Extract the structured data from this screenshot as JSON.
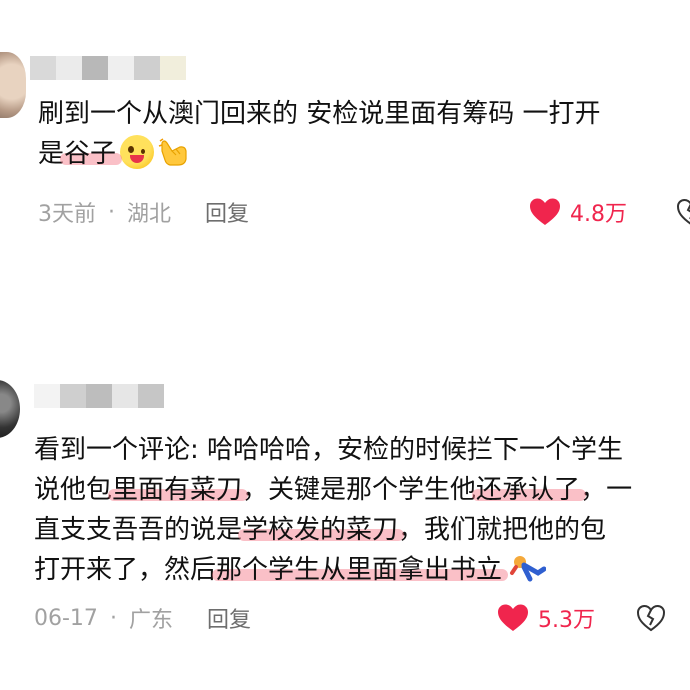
{
  "comments": [
    {
      "lines": [
        [
          {
            "text": "刷到一个从澳门回来的 安检说里面有筹码 一打开",
            "hl": false
          }
        ],
        [
          {
            "text": "是",
            "hl": false
          },
          {
            "text": "谷子",
            "hl": true
          }
        ]
      ],
      "emojis": [
        "winking-tongue-face-icon",
        "pointing-hand-icon"
      ],
      "time": "3天前",
      "location": "湖北",
      "reply_label": "回复",
      "likes": "4.8万",
      "icons": [
        "heart-icon",
        "broken-heart-icon"
      ]
    },
    {
      "lines": [
        [
          {
            "text": "看到一个评论: 哈哈哈哈，安检的时候拦下一个学生",
            "hl": false
          }
        ],
        [
          {
            "text": "说他包",
            "hl": false
          },
          {
            "text": "里面有菜刀",
            "hl": true
          },
          {
            "text": "，关键是那个学生他",
            "hl": false
          },
          {
            "text": "还承认了",
            "hl": true
          },
          {
            "text": "，一",
            "hl": false
          }
        ],
        [
          {
            "text": "直支支吾吾的说是",
            "hl": false
          },
          {
            "text": "学校发的菜刀",
            "hl": true
          },
          {
            "text": "，我们就把他的包",
            "hl": false
          }
        ],
        [
          {
            "text": "打开来了，然后",
            "hl": false
          },
          {
            "text": "那个学生从里面拿出书立",
            "hl": true
          }
        ]
      ],
      "emojis": [
        "person-tumbling-icon"
      ],
      "time": "06-17",
      "location": "广东",
      "reply_label": "回复",
      "likes": "5.3万",
      "icons": [
        "heart-icon",
        "broken-heart-icon"
      ]
    }
  ],
  "colors": {
    "highlight": "#f47482",
    "like_red": "#f0254d",
    "meta_gray": "#a1a1a1",
    "reply_gray": "#6e6e6e"
  }
}
